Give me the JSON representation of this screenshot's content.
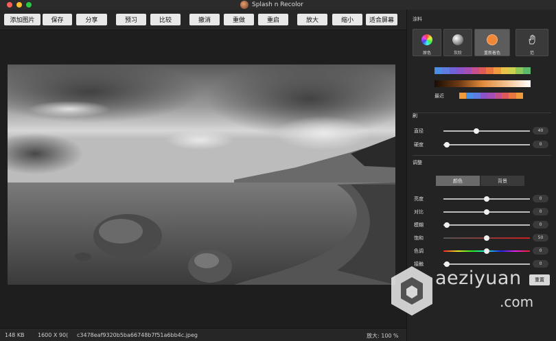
{
  "window": {
    "title": "Splash n Recolor"
  },
  "toolbar": {
    "buttons": [
      "添加图片",
      "保存",
      "分享",
      "预习",
      "比较",
      "撤消",
      "重做",
      "重启",
      "放大",
      "缩小",
      "适合屏幕"
    ]
  },
  "status": {
    "filesize": "148 KB",
    "dimensions": "1600 X 90(",
    "filename": "c3478eaf9320b5ba66748b7f51a6bb4c.jpeg",
    "zoom": "放大: 100 %"
  },
  "panel": {
    "section_paint": "涂料",
    "modes": [
      {
        "label": "原色",
        "icon": "color-wheel-icon"
      },
      {
        "label": "灰阶",
        "icon": "grayscale-ball-icon"
      },
      {
        "label": "重新着色",
        "icon": "recolor-ball-icon"
      },
      {
        "label": "范",
        "icon": "hand-pan-icon"
      }
    ],
    "palette_colors": [
      "#4a8ee6",
      "#5f7de0",
      "#6f63d8",
      "#8a55c9",
      "#a34fb6",
      "#c64f8d",
      "#de5a5a",
      "#e9753f",
      "#ef9a3d",
      "#e9c24a",
      "#c9d24f",
      "#8fc85a",
      "#5eb96a"
    ],
    "recent_label": "最近",
    "recent_colors": [
      "#ef9a3d",
      "#4a8ee6",
      "#5f7de0",
      "#8a55c9",
      "#a34fb6",
      "#c64f8d",
      "#de5a5a",
      "#e9753f",
      "#ef9a3d"
    ],
    "section_brush": "刷",
    "brush": [
      {
        "label": "直径",
        "value": "40",
        "fraction": 0.38
      },
      {
        "label": "硬度",
        "value": "0",
        "fraction": 0.04
      }
    ],
    "section_adjust": "调整",
    "segments": [
      "颜色",
      "背景"
    ],
    "adjust": [
      {
        "label": "亮度",
        "value": "0",
        "fraction": 0.5
      },
      {
        "label": "对比",
        "value": "0",
        "fraction": 0.5
      },
      {
        "label": "模糊",
        "value": "0",
        "fraction": 0.04
      },
      {
        "label": "饱和",
        "value": "50",
        "fraction": 0.5
      },
      {
        "label": "色调",
        "value": "0",
        "fraction": 0.5
      },
      {
        "label": "接触",
        "value": "0",
        "fraction": 0.04
      }
    ],
    "reset_label": "重置"
  },
  "watermark": {
    "line1": "aeziyuan",
    "line2": ".com"
  }
}
